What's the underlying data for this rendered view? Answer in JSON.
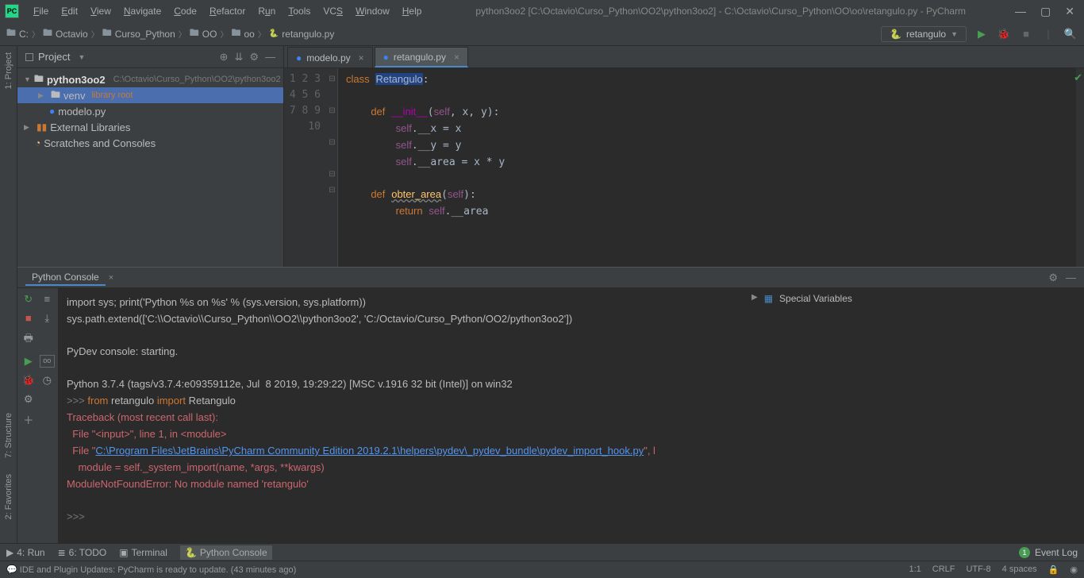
{
  "window": {
    "title": "python3oo2 [C:\\Octavio\\Curso_Python\\OO2\\python3oo2] - C:\\Octavio\\Curso_Python\\OO\\oo\\retangulo.py - PyCharm"
  },
  "menu": [
    "File",
    "Edit",
    "View",
    "Navigate",
    "Code",
    "Refactor",
    "Run",
    "Tools",
    "VCS",
    "Window",
    "Help"
  ],
  "breadcrumb": [
    "C:",
    "Octavio",
    "Curso_Python",
    "OO",
    "oo",
    "retangulo.py"
  ],
  "run_config": {
    "name": "retangulo"
  },
  "project": {
    "panel_title": "Project",
    "root": {
      "name": "python3oo2",
      "path": "C:\\Octavio\\Curso_Python\\OO2\\python3oo2"
    },
    "venv": {
      "name": "venv",
      "tag": "library root"
    },
    "modelo": "modelo.py",
    "ext_libs": "External Libraries",
    "scratches": "Scratches and Consoles"
  },
  "tabs": [
    {
      "name": "modelo.py",
      "active": false
    },
    {
      "name": "retangulo.py",
      "active": true
    }
  ],
  "code": {
    "lines": [
      "1",
      "2",
      "3",
      "4",
      "5",
      "6",
      "7",
      "8",
      "9",
      "10"
    ]
  },
  "console": {
    "tab": "Python Console",
    "vars_title": "Special Variables",
    "lines": {
      "l1": "import sys; print('Python %s on %s' % (sys.version, sys.platform))",
      "l2": "sys.path.extend(['C:\\\\Octavio\\\\Curso_Python\\\\OO2\\\\python3oo2', 'C:/Octavio/Curso_Python/OO2/python3oo2'])",
      "l3": "PyDev console: starting.",
      "l4": "Python 3.7.4 (tags/v3.7.4:e09359112e, Jul  8 2019, 19:29:22) [MSC v.1916 32 bit (Intel)] on win32",
      "prompt": ">>> ",
      "from": "from ",
      "ret": "retangulo ",
      "imp": "import ",
      "Ret": "Retangulo",
      "tb": "Traceback (most recent call last):",
      "f1": "  File \"<input>\", line 1, in <module>",
      "f2a": "  File \"",
      "f2link": "C:\\Program Files\\JetBrains\\PyCharm Community Edition 2019.2.1\\helpers\\pydev\\_pydev_bundle\\pydev_import_hook.py",
      "f2b": "\", l",
      "f3": "    module = self._system_import(name, *args, **kwargs)",
      "err": "ModuleNotFoundError: No module named 'retangulo'"
    }
  },
  "bottom_tabs": {
    "run": "4: Run",
    "todo": "6: TODO",
    "terminal": "Terminal",
    "pyconsole": "Python Console",
    "eventlog": "Event Log",
    "badge": "1"
  },
  "status": {
    "msg": "IDE and Plugin Updates: PyCharm is ready to update. (43 minutes ago)",
    "pos": "1:1",
    "crlf": "CRLF",
    "enc": "UTF-8",
    "indent": "4 spaces"
  },
  "side": {
    "project": "1: Project",
    "structure": "7: Structure",
    "favorites": "2: Favorites"
  }
}
